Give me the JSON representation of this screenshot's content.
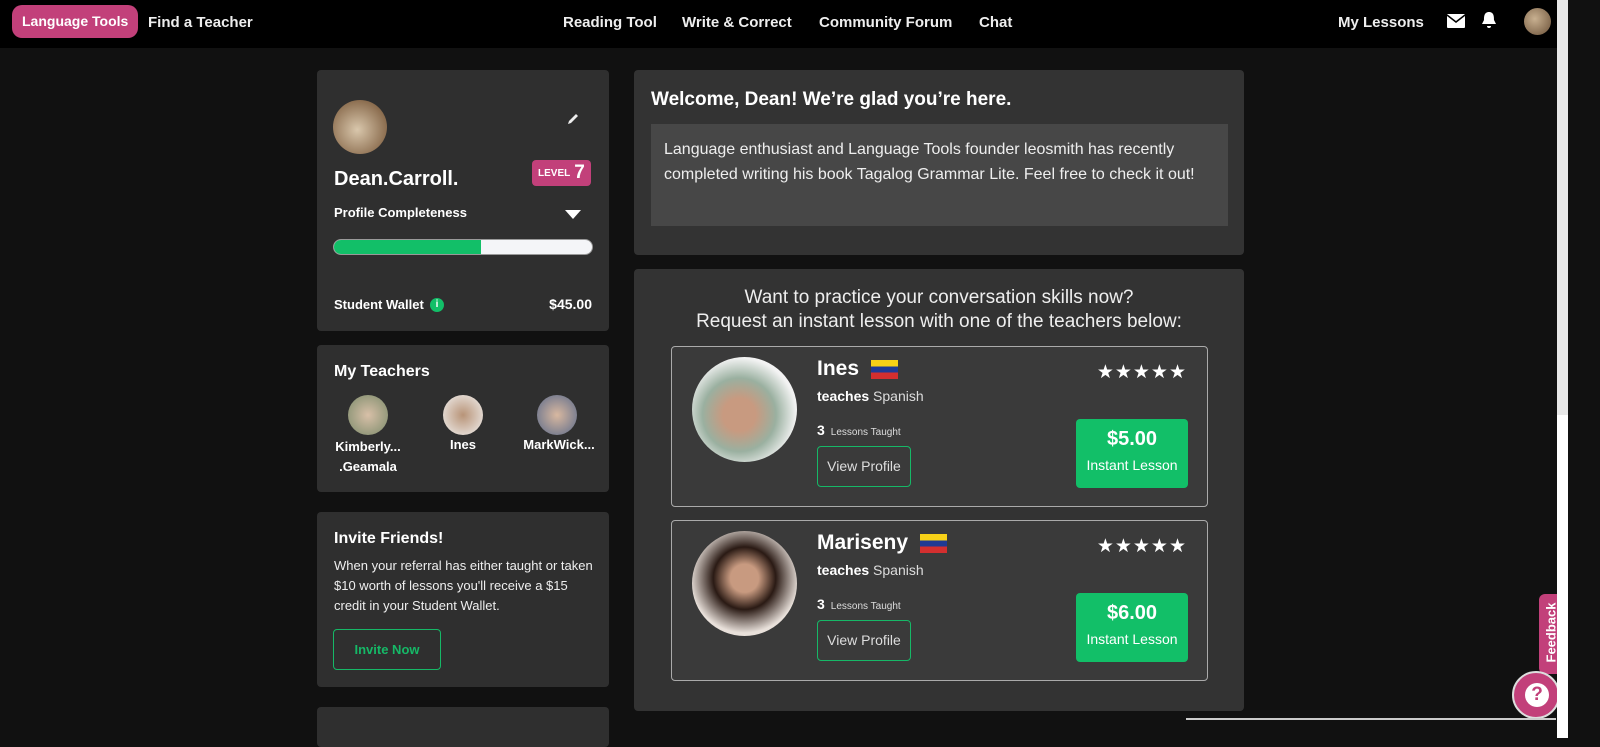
{
  "nav": {
    "brand": "Language Tools",
    "find_teacher": "Find a Teacher",
    "reading": "Reading Tool",
    "write": "Write & Correct",
    "forum": "Community Forum",
    "chat": "Chat",
    "my_lessons": "My Lessons"
  },
  "profile": {
    "name": "Dean.Carroll.",
    "level_label": "LEVEL",
    "level": "7",
    "completeness_label": "Profile Completeness",
    "completeness_percent": 57,
    "wallet_label": "Student Wallet",
    "wallet_value": "$45.00"
  },
  "my_teachers": {
    "title": "My Teachers",
    "teachers": [
      {
        "name": "Kimberly... .Geamala"
      },
      {
        "name": "Ines"
      },
      {
        "name": "MarkWick..."
      }
    ]
  },
  "invite": {
    "title": "Invite Friends!",
    "text": "When your referral has either taught or taken $10 worth of lessons you'll receive a $15 credit in your Student Wallet.",
    "button": "Invite Now"
  },
  "welcome": {
    "title": "Welcome, Dean! We’re glad you’re here.",
    "message": "Language enthusiast and Language Tools founder leosmith has recently completed writing his book Tagalog Grammar Lite. Feel free to check it out!"
  },
  "practice": {
    "line1": "Want to practice your conversation skills now?",
    "line2": "Request an instant lesson with one of the teachers below:",
    "teachers": [
      {
        "name": "Ines",
        "teaches_label": "teaches",
        "language": "Spanish",
        "lessons": "3",
        "lessons_label": "Lessons Taught",
        "stars": "★★★★★",
        "price": "$5.00",
        "instant": "Instant Lesson",
        "view": "View Profile"
      },
      {
        "name": "Mariseny",
        "teaches_label": "teaches",
        "language": "Spanish",
        "lessons": "3",
        "lessons_label": "Lessons Taught",
        "stars": "★★★★★",
        "price": "$6.00",
        "instant": "Instant Lesson",
        "view": "View Profile"
      }
    ]
  },
  "feedback": "Feedback",
  "help": "?",
  "colors": {
    "accent": "#c2407a",
    "green": "#12bf68"
  }
}
